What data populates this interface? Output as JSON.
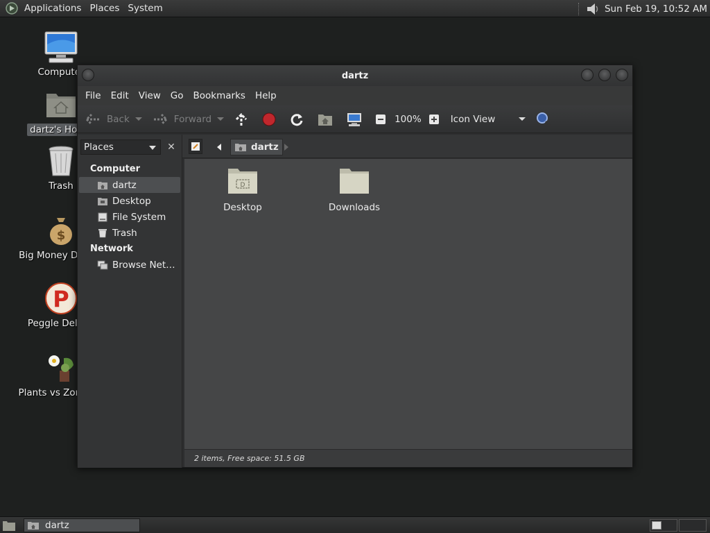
{
  "top_panel": {
    "menus": [
      "Applications",
      "Places",
      "System"
    ],
    "clock": "Sun Feb 19, 10:52 AM"
  },
  "desktop_icons": [
    {
      "label": "Computer",
      "icon": "computer-icon"
    },
    {
      "label": "dartz's Home",
      "icon": "home-folder-icon",
      "selected": true
    },
    {
      "label": "Trash",
      "icon": "trash-icon"
    },
    {
      "label": "Big Money Deluxe",
      "icon": "money-bag-icon"
    },
    {
      "label": "Peggle Deluxe",
      "icon": "peggle-icon"
    },
    {
      "label": "Plants vs Zombies",
      "icon": "plants-icon"
    }
  ],
  "window": {
    "title": "dartz",
    "menu": [
      "File",
      "Edit",
      "View",
      "Go",
      "Bookmarks",
      "Help"
    ],
    "toolbar": {
      "back": "Back",
      "forward": "Forward",
      "zoom": "100%",
      "view_mode": "Icon View"
    },
    "sidebar": {
      "selector": "Places",
      "sections": [
        {
          "heading": "Computer",
          "items": [
            {
              "label": "dartz",
              "icon": "home-icon",
              "selected": true
            },
            {
              "label": "Desktop",
              "icon": "desktop-icon"
            },
            {
              "label": "File System",
              "icon": "drive-icon"
            },
            {
              "label": "Trash",
              "icon": "trash-icon"
            }
          ]
        },
        {
          "heading": "Network",
          "items": [
            {
              "label": "Browse Net…",
              "icon": "network-icon"
            }
          ]
        }
      ]
    },
    "location": {
      "crumb": "dartz"
    },
    "files": [
      {
        "label": "Desktop",
        "icon": "desktop-folder-icon"
      },
      {
        "label": "Downloads",
        "icon": "folder-icon"
      }
    ],
    "status": "2 items, Free space: 51.5 GB"
  },
  "bottom_panel": {
    "task": "dartz"
  },
  "colors": {
    "panel": "#2f3030",
    "window_bg": "#2d2e2f",
    "content_bg": "#454647",
    "desktop_bg": "#1e201f",
    "stop_red": "#c0272d"
  }
}
